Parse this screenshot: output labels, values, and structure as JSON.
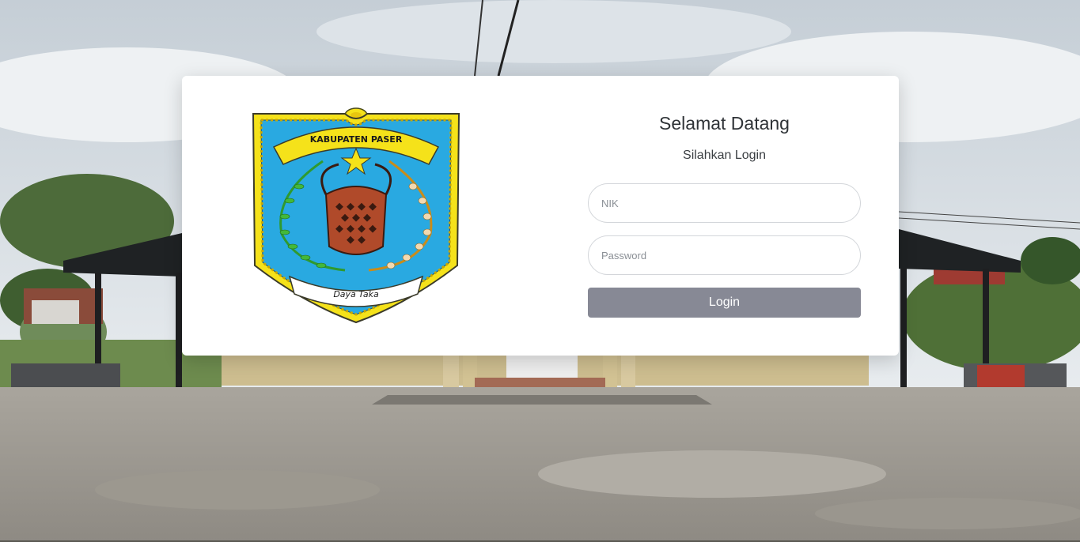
{
  "colors": {
    "card_background": "#ffffff",
    "button_background": "#878995",
    "button_text": "#ffffff",
    "field_border": "#d3d6da",
    "emblem_blue": "#29a9e1",
    "emblem_yellow": "#f5e21a",
    "emblem_brown": "#b04a2a"
  },
  "emblem": {
    "icon": "kabupaten-paser-emblem-icon",
    "banner_text": "KABUPATEN PASER",
    "motto_text": "Daya Taka"
  },
  "login": {
    "title": "Selamat Datang",
    "subtitle": "Silahkan Login",
    "nik_placeholder": "NIK",
    "password_placeholder": "Password",
    "button_label": "Login"
  }
}
